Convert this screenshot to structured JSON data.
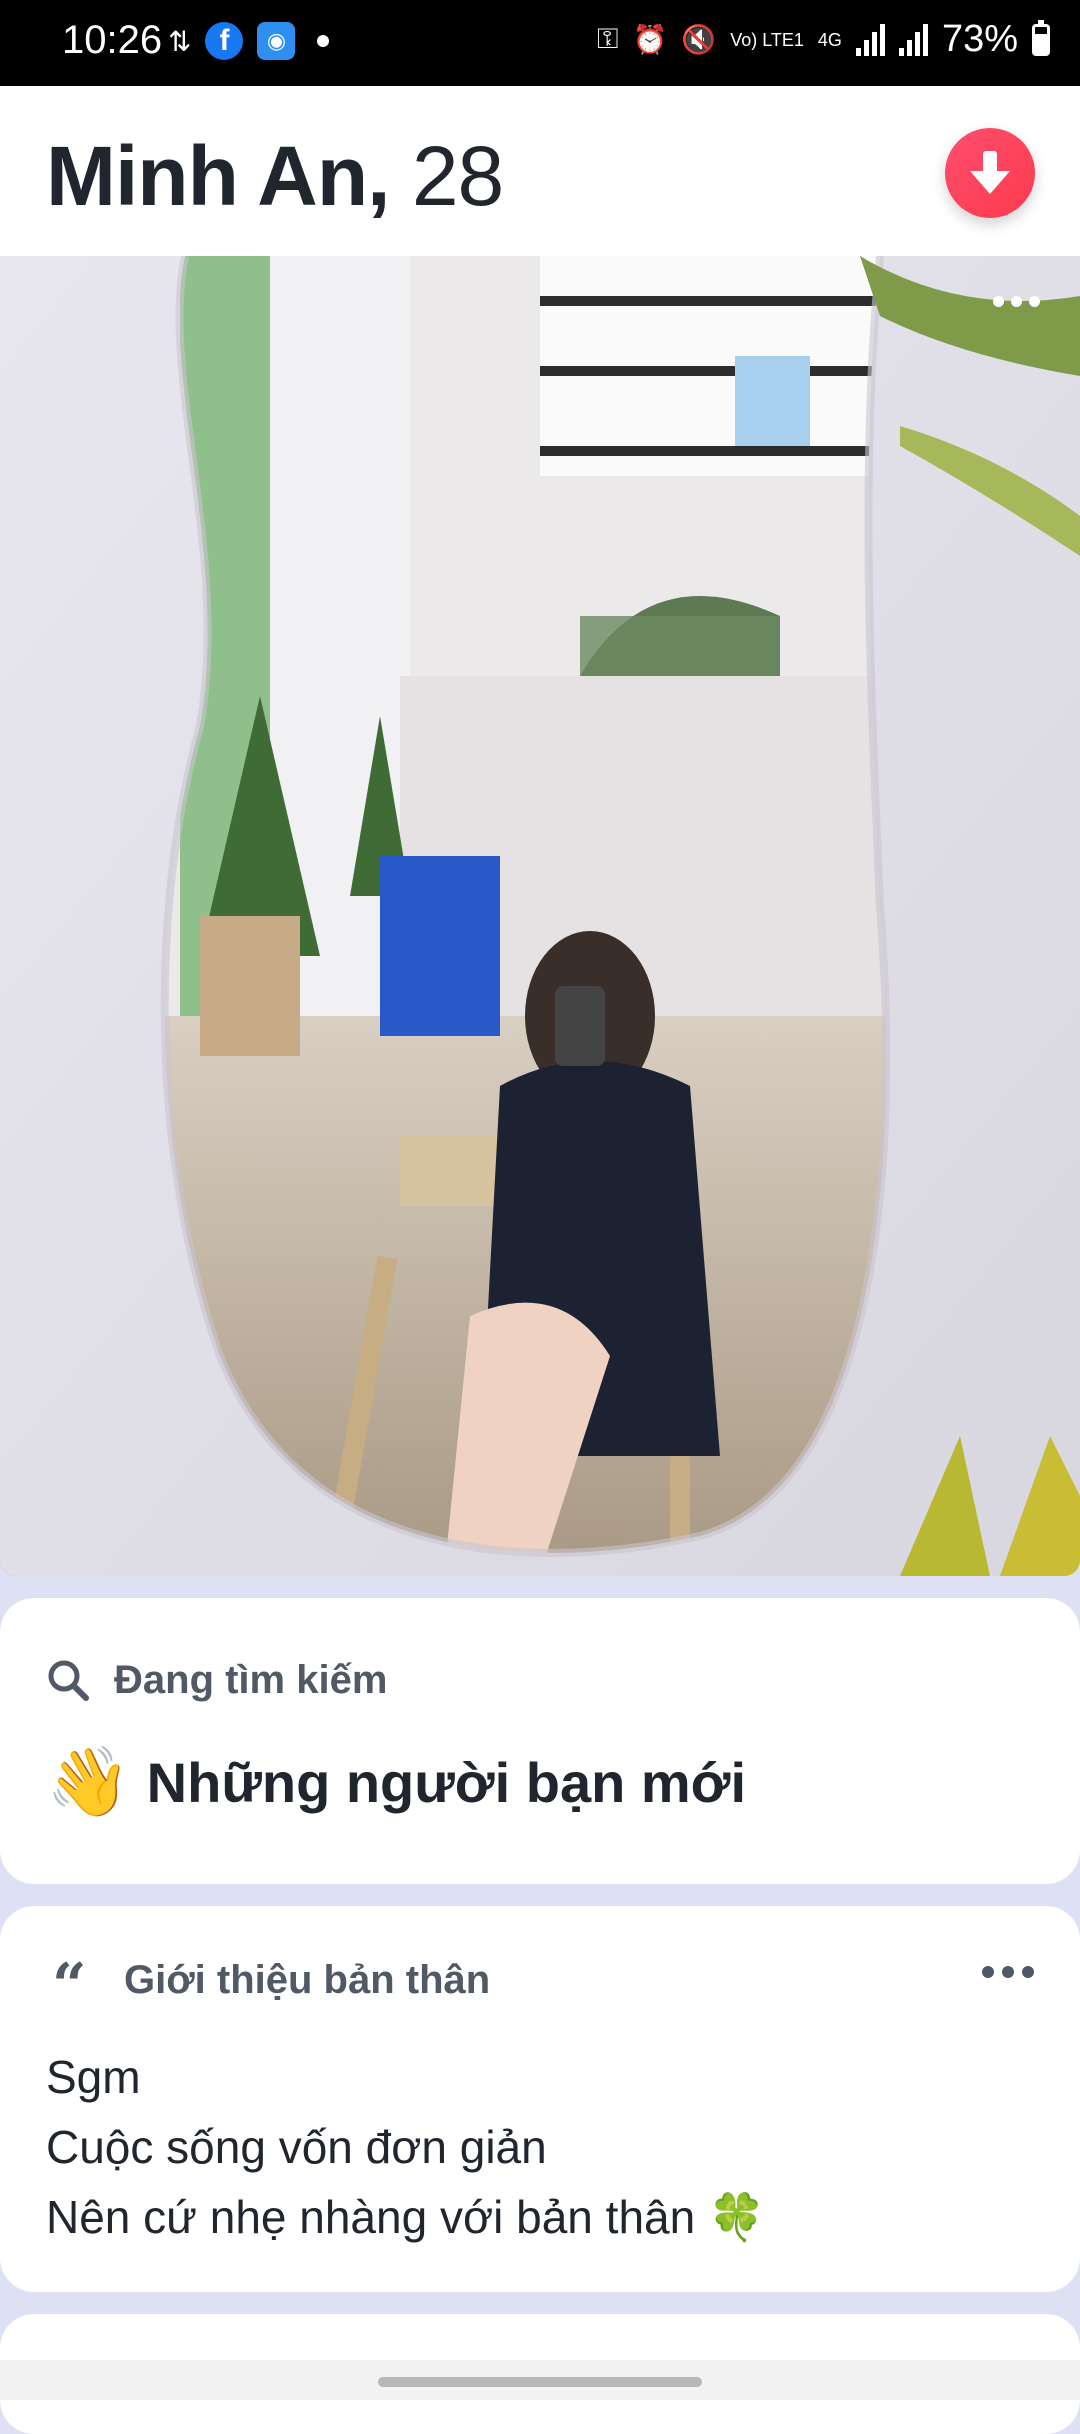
{
  "status_bar": {
    "time": "10:26",
    "network_label": "Vo) LTE1",
    "network_type": "4G",
    "battery_percent": "73%"
  },
  "header": {
    "name": "Minh An,",
    "age": "28",
    "action_icon": "arrow-down-icon",
    "action_color": "#fd3b4f"
  },
  "photo": {
    "more_icon": "more-horizontal-icon"
  },
  "looking_for": {
    "label": "Đang tìm kiếm",
    "emoji": "👋",
    "value": "Những người bạn mới"
  },
  "about_me": {
    "label": "Giới thiệu bản thân",
    "text": "Sgm\nCuộc sống vốn đơn giản\nNên cứ nhẹ nhàng với bản thân 🍀"
  }
}
